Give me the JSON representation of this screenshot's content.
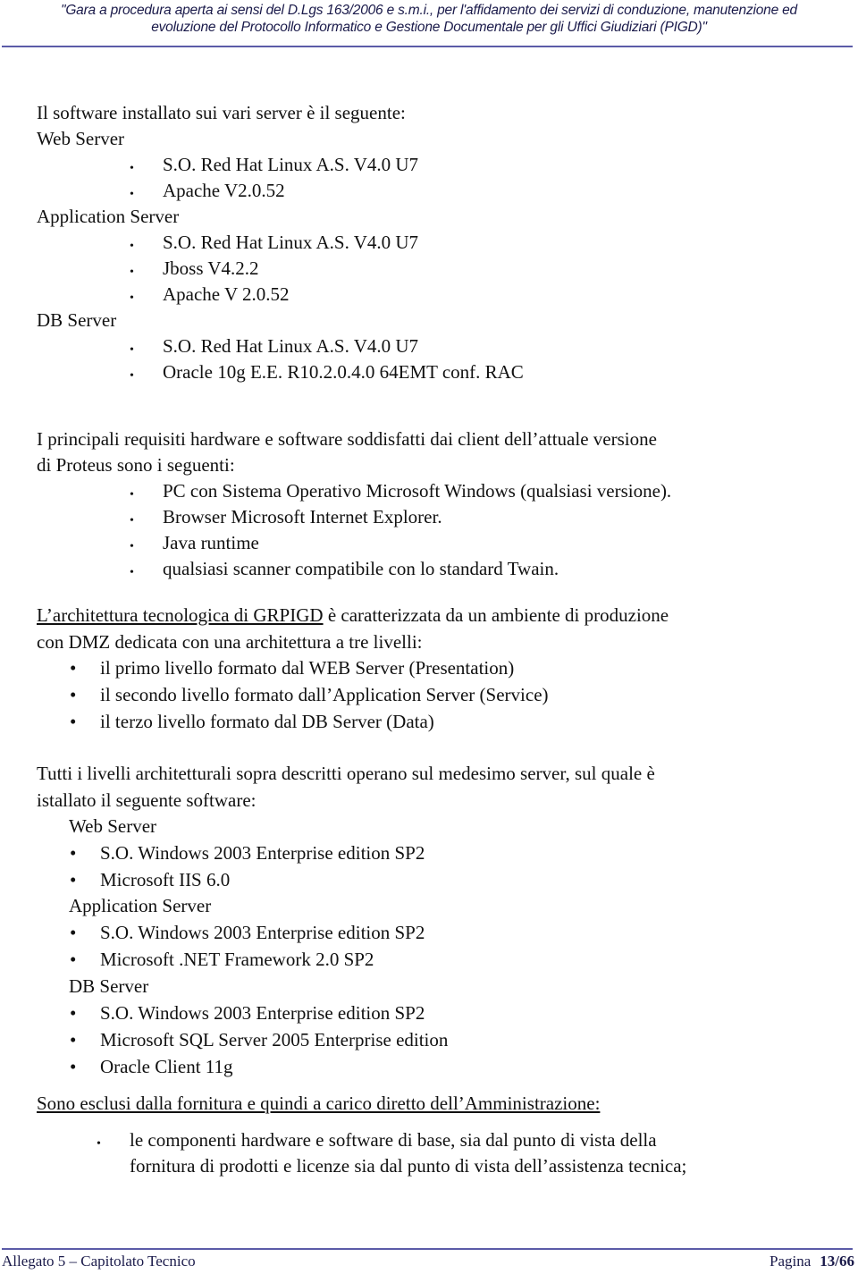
{
  "header": {
    "line1": "\"Gara a procedura aperta ai sensi del D.Lgs 163/2006 e s.m.i., per l'affidamento dei servizi di conduzione, manutenzione ed",
    "line2": "evoluzione del Protocollo Informatico e Gestione Documentale per gli Uffici Giudiziari (PIGD)\""
  },
  "section1": {
    "intro": "Il software installato sui vari server è il seguente:",
    "groups": [
      {
        "title": "Web Server",
        "items": [
          "S.O. Red Hat Linux A.S. V4.0 U7",
          "Apache V2.0.52"
        ]
      },
      {
        "title": "Application Server",
        "items": [
          "S.O. Red Hat Linux A.S. V4.0 U7",
          "Jboss V4.2.2",
          "Apache V 2.0.52"
        ]
      },
      {
        "title": "DB Server",
        "items": [
          "S.O. Red Hat Linux A.S. V4.0 U7",
          "Oracle  10g E.E. R10.2.0.4.0 64EMT conf. RAC"
        ]
      }
    ]
  },
  "section2": {
    "intro_line1": "I principali requisiti hardware e software  soddisfatti dai client dell’attuale versione",
    "intro_line2": "di Proteus sono i seguenti:",
    "items": [
      "PC con Sistema Operativo Microsoft Windows (qualsiasi versione).",
      "Browser Microsoft Internet Explorer.",
      "Java runtime",
      "qualsiasi scanner compatibile con lo standard Twain."
    ]
  },
  "section3": {
    "intro_underlined": "L’architettura tecnologica di GRPIGD",
    "intro_rest": " è caratterizzata da un ambiente di produzione",
    "intro_line2": "con DMZ dedicata con una architettura a tre livelli:",
    "items": [
      "il primo livello formato dal WEB Server  (Presentation)",
      "il secondo livello formato dall’Application Server (Service)",
      "il terzo livello formato dal DB Server (Data)"
    ]
  },
  "section4": {
    "intro_line1": "Tutti i livelli architetturali sopra descritti operano sul medesimo server, sul quale è",
    "intro_line2": "istallato il seguente software:",
    "groups": [
      {
        "title": "Web Server",
        "items": [
          "S.O. Windows 2003 Enterprise edition SP2",
          "Microsoft IIS 6.0"
        ]
      },
      {
        "title": "Application Server",
        "items": [
          "S.O. Windows 2003 Enterprise edition SP2",
          "Microsoft .NET Framework 2.0 SP2"
        ]
      },
      {
        "title": "DB Server",
        "items": [
          "S.O. Windows 2003 Enterprise edition SP2",
          "Microsoft SQL Server 2005 Enterprise edition",
          "Oracle Client 11g"
        ]
      }
    ]
  },
  "section5": {
    "heading": "Sono esclusi dalla fornitura e quindi a carico diretto dell’Amministrazione:",
    "item_line1": "le componenti hardware e software di base, sia dal punto di vista della",
    "item_line2": "fornitura di prodotti e licenze sia dal punto di vista dell’assistenza tecnica;"
  },
  "footer": {
    "left": "Allegato 5 – Capitolato Tecnico",
    "page_label": "Pagina",
    "page_number": "13/66"
  }
}
